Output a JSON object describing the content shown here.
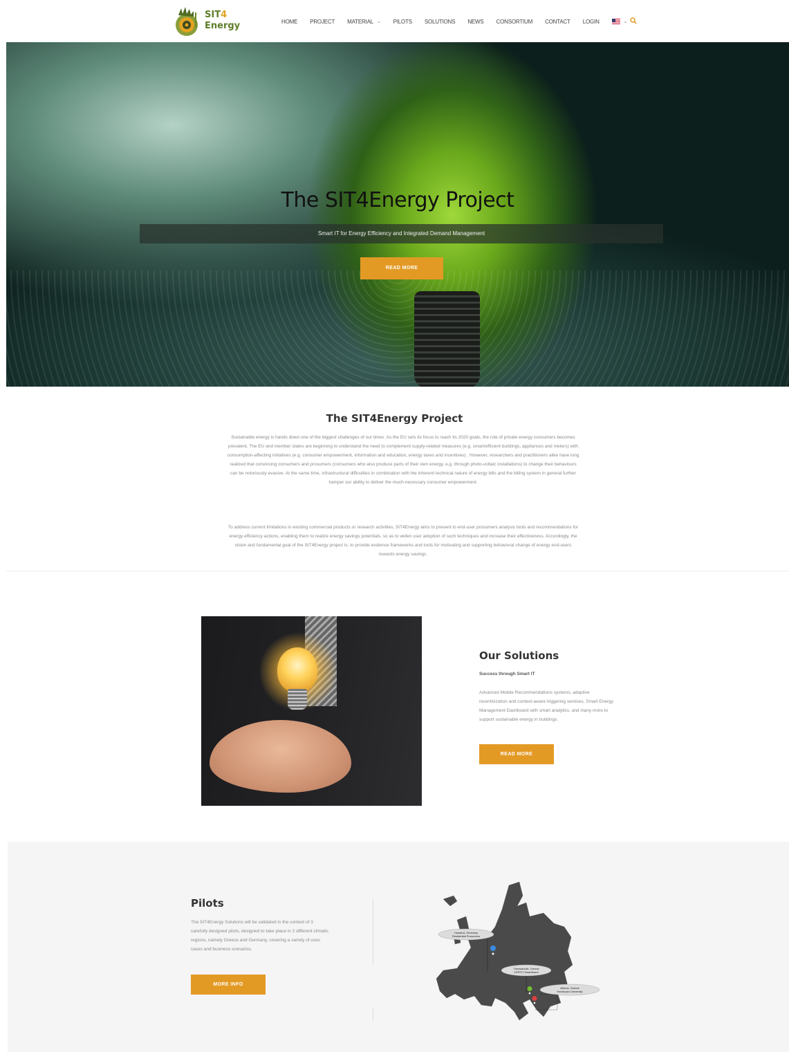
{
  "brand": {
    "line1": "SIT",
    "line1_num": "4",
    "line2": "Energy",
    "colors": {
      "green": "#5e7e2a",
      "orange": "#e2a320",
      "accent": "#e39a25"
    }
  },
  "nav": {
    "items": [
      {
        "label": "HOME"
      },
      {
        "label": "PROJECT"
      },
      {
        "label": "MATERIAL",
        "has_dropdown": true
      },
      {
        "label": "PILOTS"
      },
      {
        "label": "SOLUTIONS"
      },
      {
        "label": "NEWS"
      },
      {
        "label": "CONSORTIUM"
      },
      {
        "label": "CONTACT"
      },
      {
        "label": "LOGIN"
      }
    ],
    "language_icon": "us-flag-icon",
    "search_icon": "search-icon"
  },
  "hero": {
    "title": "The SIT4Energy Project",
    "subtitle": "Smart IT for Energy Efficiency and Integrated Demand Management",
    "button": "READ MORE"
  },
  "intro": {
    "title": "The SIT4Energy Project",
    "paragraph1": "Sustainable energy is hands down one of the biggest challenges of our times. As the EU sets its focus to reach its 2020 goals, the role of private energy consumers becomes prevalent. The EU and member states are beginning to understand the need to complement supply-related measures (e.g. smart/efficient buildings, appliances and meters) with consumption-affecting initiatives (e.g. consumer empowerment, information and education, energy taxes and incentives) . However, researchers and practitioners alike have long realized that convincing consumers and prosumers (consumers who also produce parts of their own energy, e.g. through photo-voltaic installations) to change their behaviours can be notoriously evasive. At the same time, infrastructural difficulties in combination with the inherent technical nature of energy bills and the billing system in general further hamper our ability to deliver the much-necessary consumer empowerment.",
    "paragraph2": "To address current limitations in existing commercial products or research activities, SIT4Energy aims to present to end-user prosumers analysis tools and recommendations for energy efficiency actions, enabling them to realize energy savings potentials, so as to widen user adoption of such techniques and increase their effectiveness. Accordingly, the vision and fundamental goal of the SIT4Energy project is: to provide evidence frameworks and tools for motivating and supporting behavioral change of energy end-users towards energy savings."
  },
  "solutions": {
    "title": "Our Solutions",
    "subtitle": "Success through Smart IT",
    "body": "Advanced Mobile Recommendations systems, adaptive incentivization and context-aware triggering services, Smart Energy Management Dashboard with smart analytics, and many more to support sustainable energy in buildings.",
    "button": "READ MORE"
  },
  "pilots": {
    "title": "Pilots",
    "body": "The SIT4Energy Solutions will be validated in the context of 3 carefully designed pilots, designed to take place in 2 different climatic regions, namely Greece and Germany, covering a variety of uses cases and business scenarios.",
    "button": "MORE INFO",
    "map_labels": [
      {
        "line1": "Hassfurt, Germany",
        "line2": "Residential Prosumers"
      },
      {
        "line1": "Thessaloniki, Greece",
        "line2": "CERTH Smarthome"
      },
      {
        "line1": "Athens, Greece",
        "line2": "Harokopio University"
      }
    ]
  }
}
